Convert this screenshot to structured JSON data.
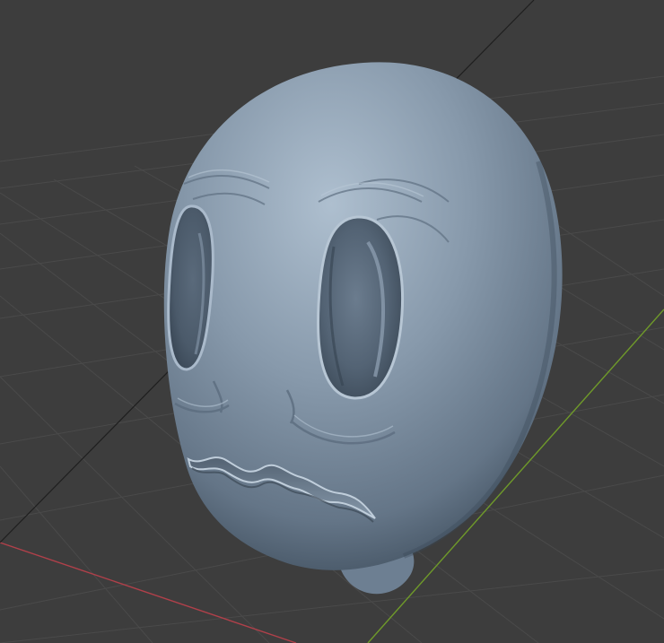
{
  "viewport": {
    "label": "3D Viewport",
    "background_color": "#3d3d3d",
    "grid_line_color": "#4a4a4a",
    "x_axis_color": "#b0404a",
    "y_axis_color": "#6f9a2a",
    "sculpt_base_color": "#7d90a3",
    "sculpt_highlight_color": "#a7b8c9",
    "sculpt_shadow_color": "#41505f"
  },
  "scene_object": {
    "name": "",
    "shape": "rounded ghost head sculpt with two eye sockets and a wavy mouth",
    "icon": "sculpt-mesh-icon"
  }
}
